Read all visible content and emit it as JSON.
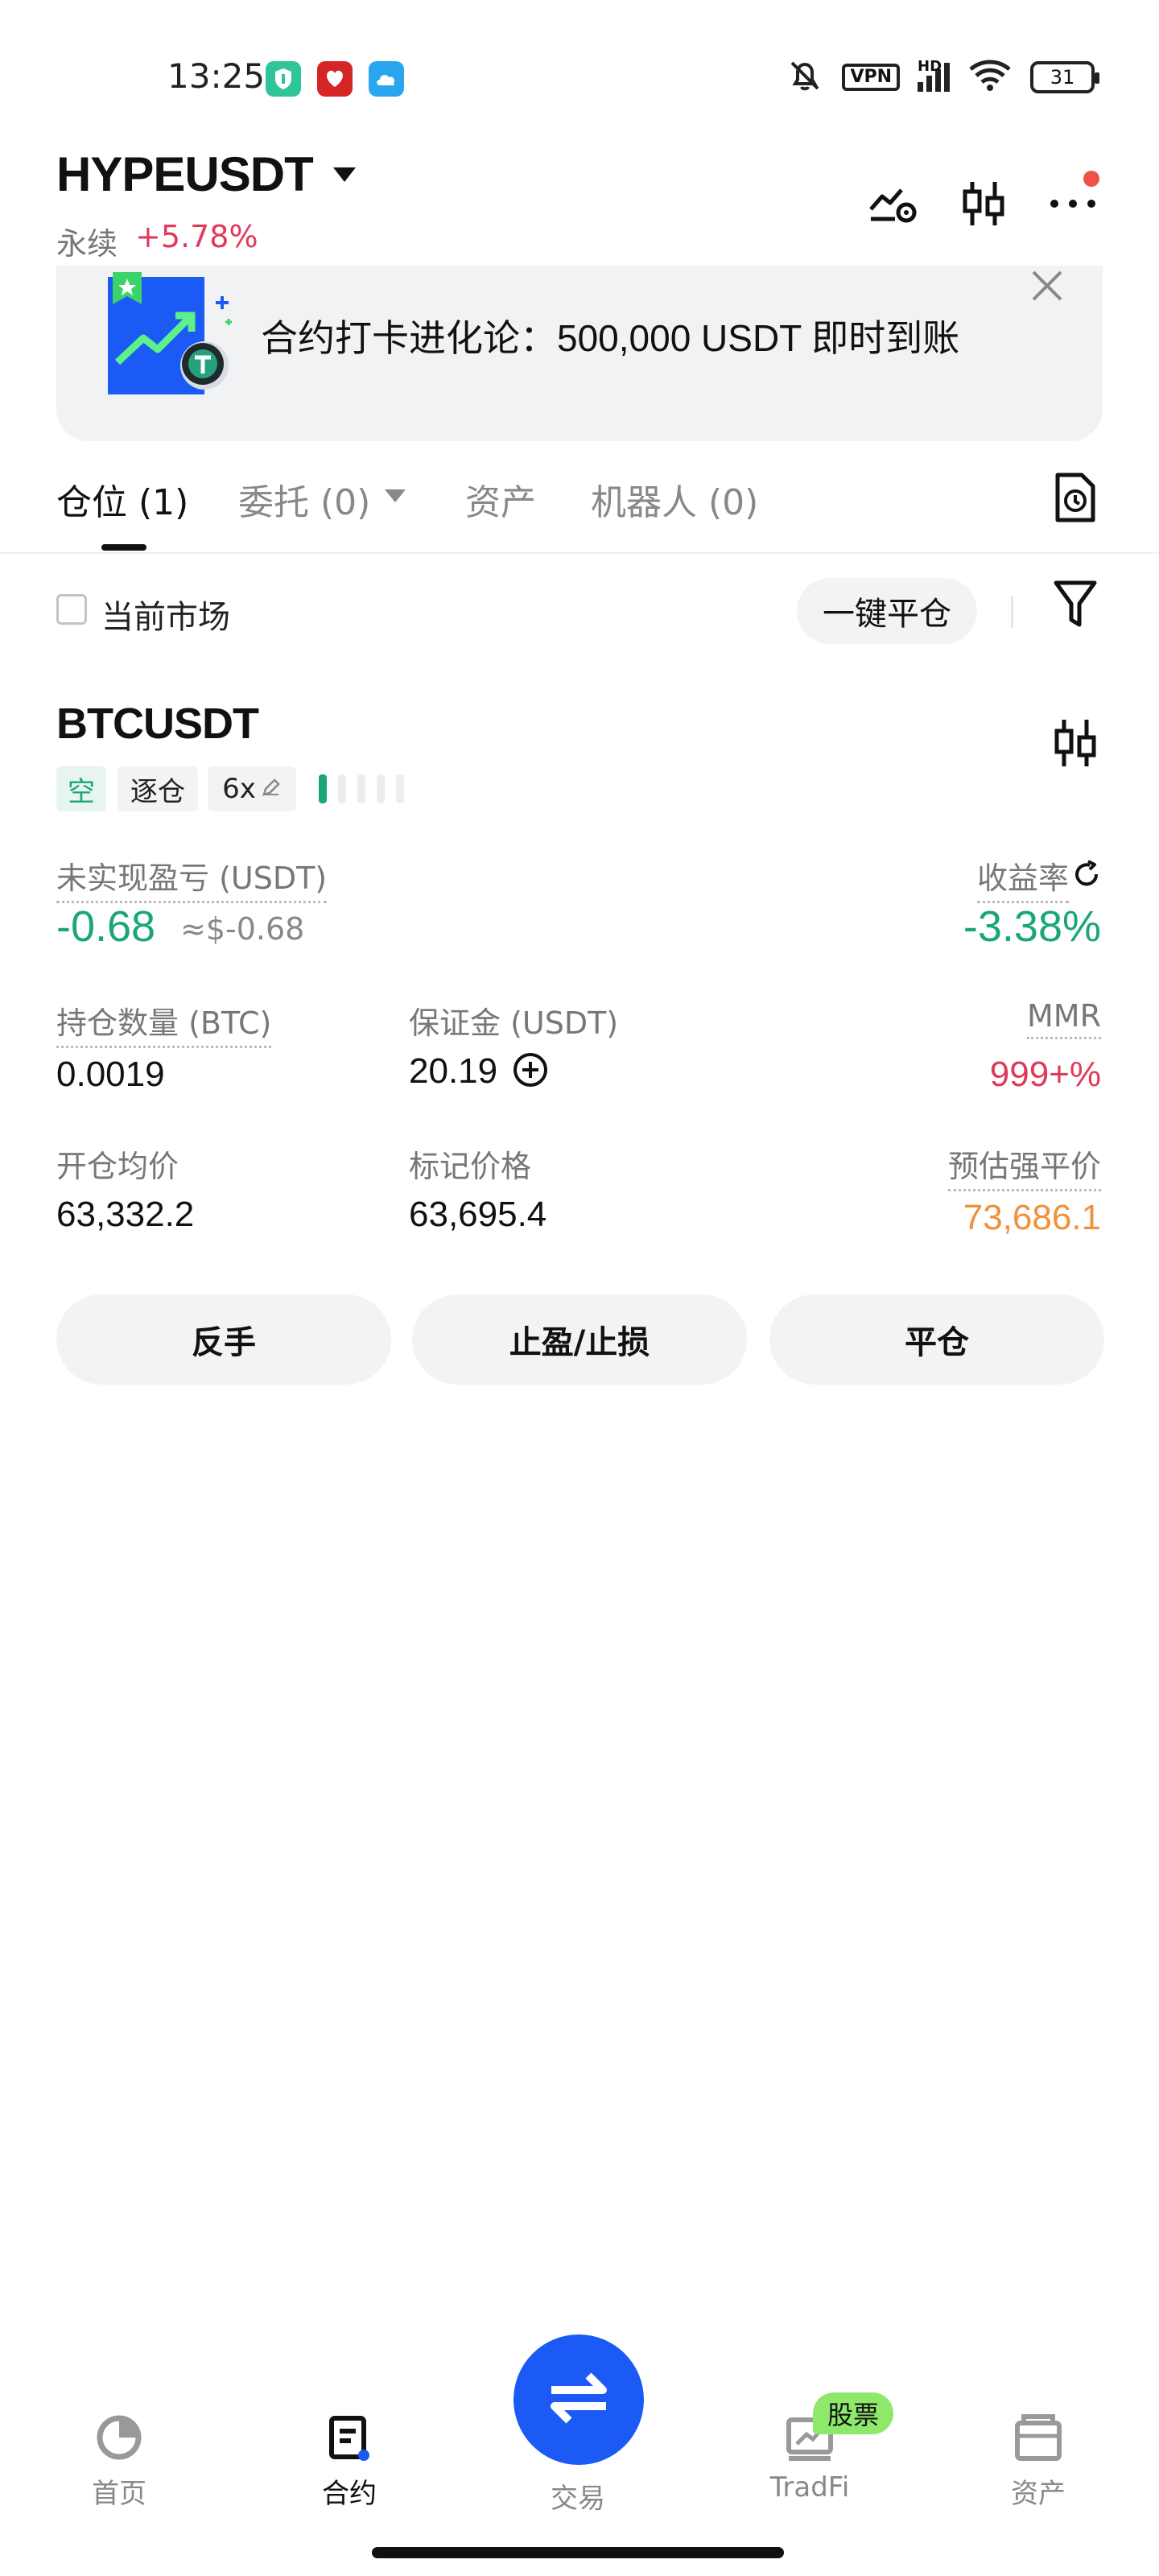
{
  "status_bar": {
    "time": "13:25",
    "vpn": "VPN",
    "hd": "HD",
    "battery": "31"
  },
  "header": {
    "pair": "HYPEUSDT",
    "contract_type": "永续",
    "change": "+5.78%"
  },
  "banner": {
    "text": "合约打卡进化论：500,000 USDT 即时到账"
  },
  "tabs": [
    {
      "label": "仓位 (1)"
    },
    {
      "label": "委托 (0)"
    },
    {
      "label": "资产"
    },
    {
      "label": "机器人 (0)"
    }
  ],
  "filter": {
    "current_market_label": "当前市场",
    "close_all_label": "一键平仓"
  },
  "position": {
    "symbol": "BTCUSDT",
    "side_tag": "空",
    "margin_mode_tag": "逐仓",
    "leverage_tag": "6x",
    "risk_level": 0.2,
    "unrealized_pnl_label": "未实现盈亏 (USDT)",
    "unrealized_pnl": "-0.68",
    "unrealized_pnl_usd": "≈$-0.68",
    "roe_label": "收益率",
    "roe": "-3.38%",
    "size_label": "持仓数量 (BTC)",
    "size": "0.0019",
    "margin_label": "保证金 (USDT)",
    "margin": "20.19",
    "mmr_label": "MMR",
    "mmr": "999+%",
    "entry_price_label": "开仓均价",
    "entry_price": "63,332.2",
    "mark_price_label": "标记价格",
    "mark_price": "63,695.4",
    "liq_price_label": "预估强平价",
    "liq_price": "73,686.1"
  },
  "actions": {
    "reverse": "反手",
    "tp_sl": "止盈/止损",
    "close": "平仓"
  },
  "bottom_nav": {
    "home": "首页",
    "futures": "合约",
    "trade": "交易",
    "tradfi": "TradFi",
    "tradfi_badge": "股票",
    "assets": "资产"
  },
  "colors": {
    "green": "#1aa57a",
    "red": "#e03a5a",
    "orange": "#f0913a",
    "brand_blue": "#1b5af5",
    "badge_green": "#8ee86c"
  }
}
